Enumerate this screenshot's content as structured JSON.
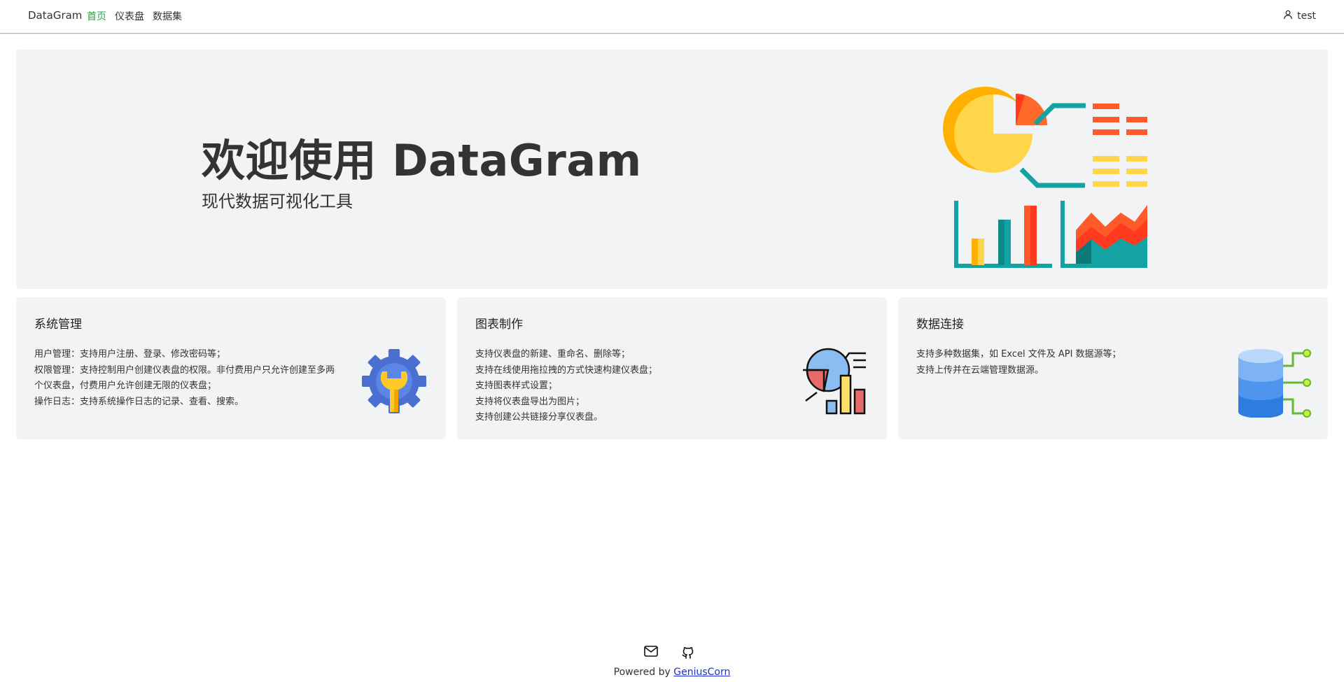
{
  "nav": {
    "brand": "DataGram",
    "links": [
      "首页",
      "仪表盘",
      "数据集"
    ],
    "user": "test"
  },
  "hero": {
    "title": "欢迎使用 DataGram",
    "subtitle": "现代数据可视化工具",
    "illustration": "analytics-illustration"
  },
  "cards": [
    {
      "title": "系统管理",
      "icon": "gear-wrench-icon",
      "lines": [
        "用户管理：支持用户注册、登录、修改密码等；",
        "权限管理：支持控制用户创建仪表盘的权限。非付费用户只允许创建至多两",
        "个仪表盘，付费用户允许创建无限的仪表盘；",
        "操作日志：支持系统操作日志的记录、查看、搜索。"
      ]
    },
    {
      "title": "图表制作",
      "icon": "chart-making-icon",
      "lines": [
        "支持仪表盘的新建、重命名、删除等；",
        "支持在线使用拖拉拽的方式快速构建仪表盘；",
        "支持图表样式设置；",
        "支持将仪表盘导出为图片；",
        "支持创建公共链接分享仪表盘。"
      ]
    },
    {
      "title": "数据连接",
      "icon": "database-icon",
      "lines": [
        "支持多种数据集，如 Excel 文件及 API 数据源等；",
        "支持上传并在云端管理数据源。"
      ]
    }
  ],
  "footer": {
    "icons": [
      "mail-icon",
      "github-icon"
    ],
    "powered_by": "Powered by",
    "author": "GeniusCorn"
  }
}
